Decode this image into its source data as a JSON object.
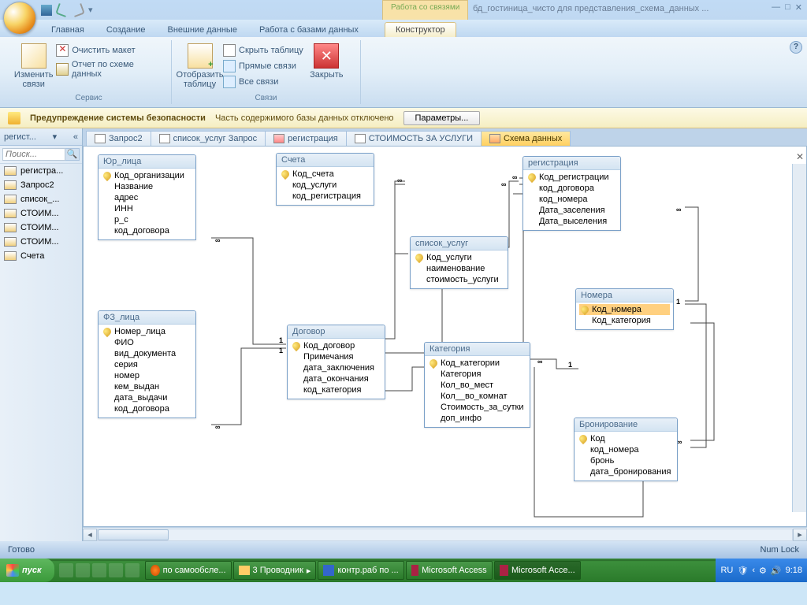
{
  "title_context": "Работа со связями",
  "doc_title": "бд_гостиница_чисто для представления_схема_данных ...",
  "ribbon_tabs": [
    "Главная",
    "Создание",
    "Внешние данные",
    "Работа с базами данных"
  ],
  "ribbon_ctx": "Конструктор",
  "grp": {
    "service": "Сервис",
    "links": "Связи",
    "edit": "Изменить связи",
    "clear": "Очистить макет",
    "report": "Отчет по схеме данных",
    "show": "Отобразить таблицу",
    "hide": "Скрыть таблицу",
    "direct": "Прямые связи",
    "all": "Все связи",
    "close": "Закрыть"
  },
  "warn": {
    "title": "Предупреждение системы безопасности",
    "text": "Часть содержимого базы данных отключено",
    "btn": "Параметры..."
  },
  "nav": {
    "hdr": "регист...",
    "search": "Поиск...",
    "items": [
      "регистра...",
      "Запрос2",
      "список_...",
      "СТОИМ...",
      "СТОИМ...",
      "СТОИМ...",
      "Счета"
    ]
  },
  "tabs": [
    "Запрос2",
    "список_услуг Запрос",
    "регистрация",
    "СТОИМОСТЬ ЗА УСЛУГИ",
    "Схема данных"
  ],
  "tables": {
    "yur": {
      "title": "Юр_лица",
      "fields": [
        "Код_организации",
        "Название",
        "адрес",
        "ИНН",
        "р_с",
        "код_договора"
      ],
      "pk": [
        0
      ]
    },
    "scheta": {
      "title": "Счета",
      "fields": [
        "Код_счета",
        "код_услуги",
        "код_регистрация"
      ],
      "pk": [
        0
      ]
    },
    "reg": {
      "title": "регистрация",
      "fields": [
        "Код_регистрации",
        "код_договора",
        "код_номера",
        "Дата_заселения",
        "Дата_выселения"
      ],
      "pk": [
        0
      ]
    },
    "uslugi": {
      "title": "список_услуг",
      "fields": [
        "Код_услуги",
        "наименование",
        "стоимость_услуги"
      ],
      "pk": [
        0
      ]
    },
    "nomera": {
      "title": "Номера",
      "fields": [
        "Код_номера",
        "Код_категория"
      ],
      "pk": [
        0
      ],
      "sel": 0
    },
    "fz": {
      "title": "ФЗ_лица",
      "fields": [
        "Номер_лица",
        "ФИО",
        "вид_документа",
        "серия",
        "номер",
        "кем_выдан",
        "дата_выдачи",
        "код_договора"
      ],
      "pk": [
        0
      ]
    },
    "dogovor": {
      "title": "Договор",
      "fields": [
        "Код_договор",
        "Примечания",
        "дата_заключения",
        "дата_окончания",
        "код_категория"
      ],
      "pk": [
        0
      ]
    },
    "kategoria": {
      "title": "Категория",
      "fields": [
        "Код_категории",
        "Категория",
        "Кол_во_мест",
        "Кол__во_комнат",
        "Стоимость_за_сутки",
        "доп_инфо"
      ],
      "pk": [
        0
      ]
    },
    "bron": {
      "title": "Бронирование",
      "fields": [
        "Код",
        "код_номера",
        "бронь",
        "дата_бронирования"
      ],
      "pk": [
        0
      ]
    }
  },
  "status": {
    "ready": "Готово",
    "numlock": "Num Lock"
  },
  "taskbar": {
    "start": "пуск",
    "items": [
      "по самообсле...",
      "3 Проводник",
      "контр.раб по ...",
      "Microsoft Access",
      "Microsoft Acce..."
    ],
    "lang": "RU",
    "time": "9:18"
  }
}
